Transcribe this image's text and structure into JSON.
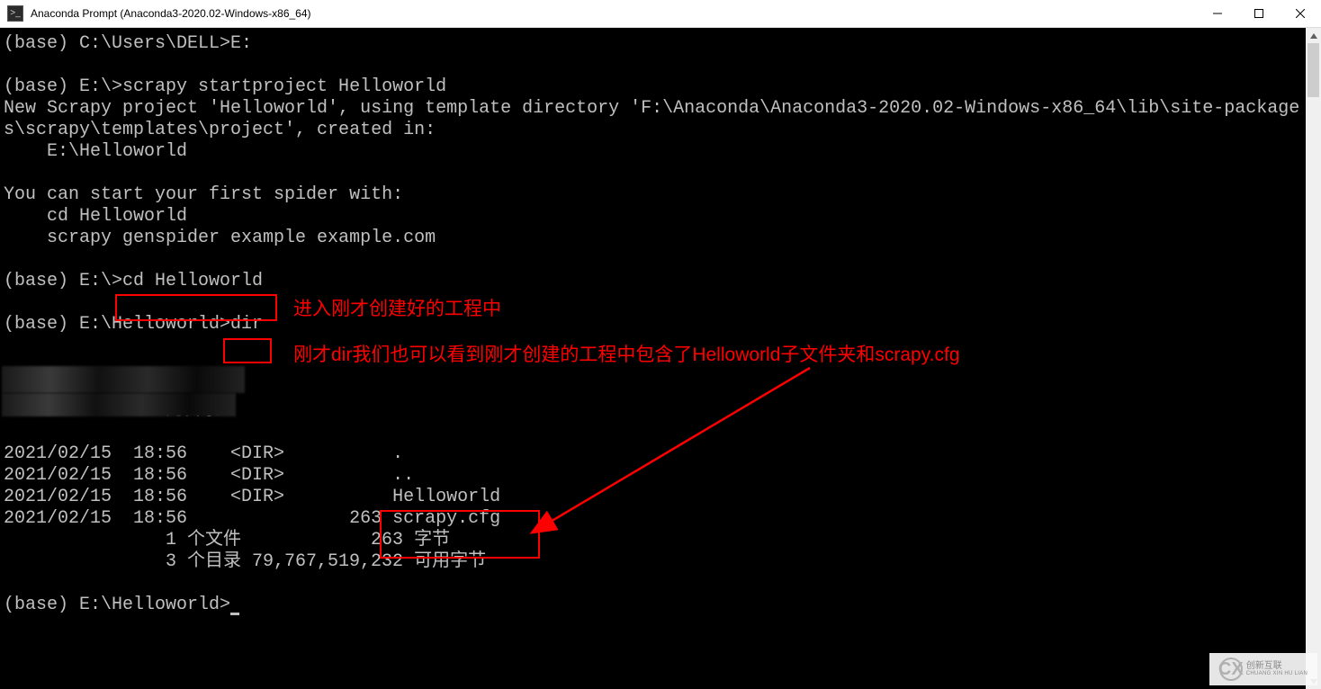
{
  "window": {
    "title": "Anaconda Prompt (Anaconda3-2020.02-Windows-x86_64)"
  },
  "terminal": {
    "line1": "(base) C:\\Users\\DELL>E:",
    "line2": "",
    "line3": "(base) E:\\>scrapy startproject Helloworld",
    "line4": "New Scrapy project 'Helloworld', using template directory 'F:\\Anaconda\\Anaconda3-2020.02-Windows-x86_64\\lib\\site-package",
    "line5": "s\\scrapy\\templates\\project', created in:",
    "line6": "    E:\\Helloworld",
    "line7": "",
    "line8": "You can start your first spider with:",
    "line9": "    cd Helloworld",
    "line10": "    scrapy genspider example example.com",
    "line11": "",
    "line12_pre": "(base) E:\\>",
    "line12_cmd": "cd Helloworld",
    "line13": "",
    "line14_pre": "(base) E:\\Helloworld>",
    "line14_cmd": "dir",
    "line18": " E:\\Helloworld 的目录",
    "line19": "",
    "line20": "2021/02/15  18:56    <DIR>          .",
    "line21": "2021/02/15  18:56    <DIR>          ..",
    "line22": "2021/02/15  18:56    <DIR>          Helloworld",
    "line23": "2021/02/15  18:56               263 scrapy.cfg",
    "line24": "               1 个文件            263 字节",
    "line25": "               3 个目录 79,767,519,232 可用字节",
    "line26": "",
    "line27": "(base) E:\\Helloworld>"
  },
  "annotations": {
    "annot1": "进入刚才创建好的工程中",
    "annot2": "刚才dir我们也可以看到刚才创建的工程中包含了Helloworld子文件夹和scrapy.cfg"
  },
  "watermark": {
    "brand_cn": "创新互联",
    "brand_en": "CHUANG XIN HU LIAN"
  }
}
